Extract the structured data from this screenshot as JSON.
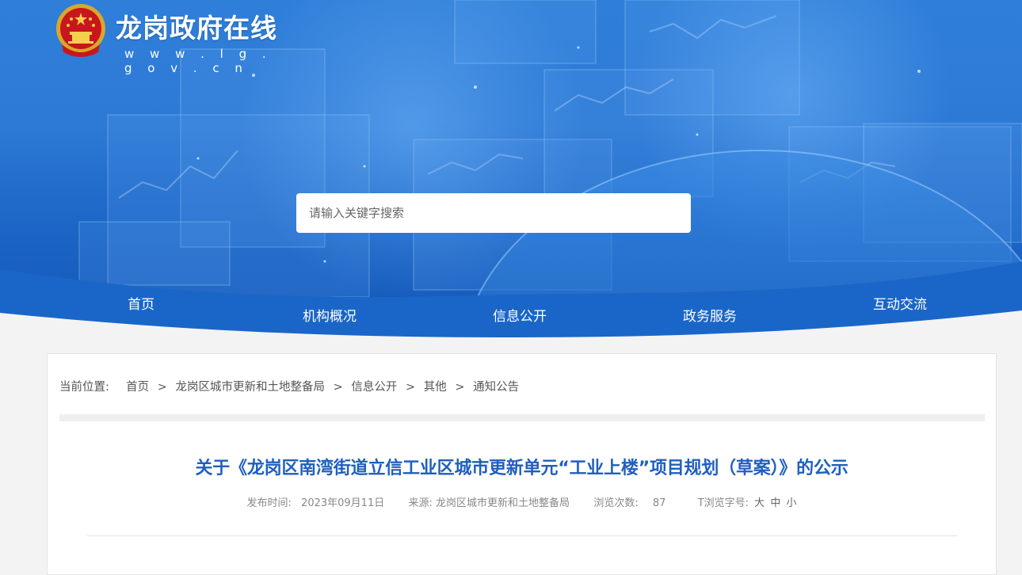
{
  "site": {
    "title": "龙岗政府在线",
    "url": "w w w . l g . g o v . c n"
  },
  "search": {
    "placeholder": "请输入关键字搜索"
  },
  "nav": {
    "items": [
      "首页",
      "机构概况",
      "信息公开",
      "政务服务",
      "互动交流"
    ]
  },
  "breadcrumb": {
    "label": "当前位置:",
    "items": [
      "首页",
      "龙岗区城市更新和土地整备局",
      "信息公开",
      "其他",
      "通知公告"
    ],
    "separator": ">"
  },
  "article": {
    "title": "关于《龙岗区南湾街道立信工业区城市更新单元“工业上楼”项目规划（草案）》的公示",
    "publish_label": "发布时间:",
    "publish_date": "2023年09月11日",
    "source_label": "来源:",
    "source": "龙岗区城市更新和土地整备局",
    "views_label": "浏览次数:",
    "views": "87",
    "font_label": "T浏览字号:",
    "font_large": "大",
    "font_medium": "中",
    "font_small": "小"
  },
  "colors": {
    "banner_blue": "#2d7ad6",
    "nav_wave": "#1a66c8",
    "title_blue": "#1f5fbf"
  }
}
